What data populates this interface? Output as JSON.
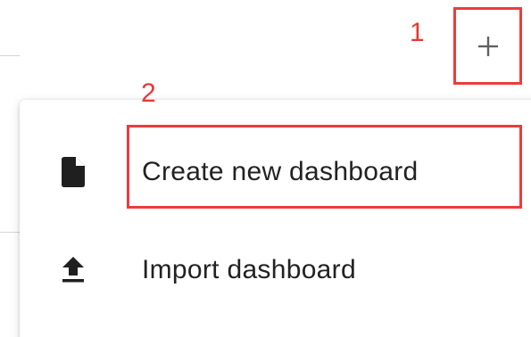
{
  "annotations": {
    "step_1": "1",
    "step_2": "2",
    "highlight_color": "#ef3b3b"
  },
  "toolbar": {
    "add_icon": "plus-icon"
  },
  "menu": {
    "items": [
      {
        "label": "Create new dashboard",
        "icon": "file-icon"
      },
      {
        "label": "Import dashboard",
        "icon": "upload-icon"
      }
    ]
  }
}
